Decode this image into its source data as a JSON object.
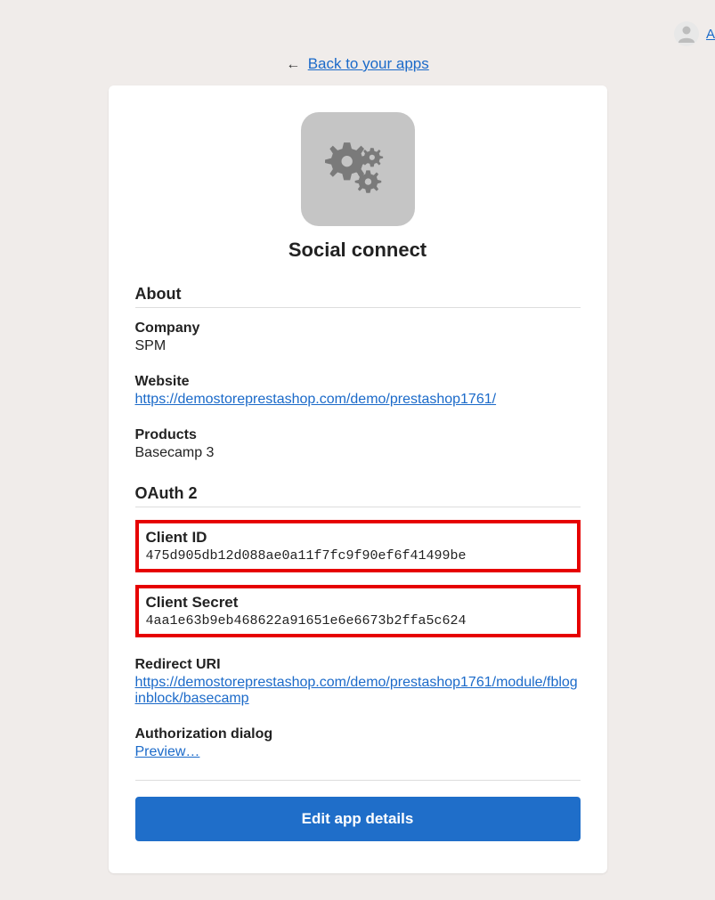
{
  "header": {
    "back_link": "Back to your apps",
    "account_link": "A",
    "back_arrow": "←"
  },
  "app": {
    "title": "Social connect"
  },
  "about": {
    "heading": "About",
    "company_label": "Company",
    "company_value": "SPM",
    "website_label": "Website",
    "website_value": "https://demostoreprestashop.com/demo/prestashop1761/",
    "products_label": "Products",
    "products_value": "Basecamp 3"
  },
  "oauth": {
    "heading": "OAuth 2",
    "client_id_label": "Client ID",
    "client_id_value": "475d905db12d088ae0a11f7fc9f90ef6f41499be",
    "client_secret_label": "Client Secret",
    "client_secret_value": "4aa1e63b9eb468622a91651e6e6673b2ffa5c624",
    "redirect_uri_label": "Redirect URI",
    "redirect_uri_value": "https://demostoreprestashop.com/demo/prestashop1761/module/fbloginblock/basecamp",
    "auth_dialog_label": "Authorization dialog",
    "auth_dialog_link": "Preview…"
  },
  "actions": {
    "edit_button": "Edit app details"
  }
}
